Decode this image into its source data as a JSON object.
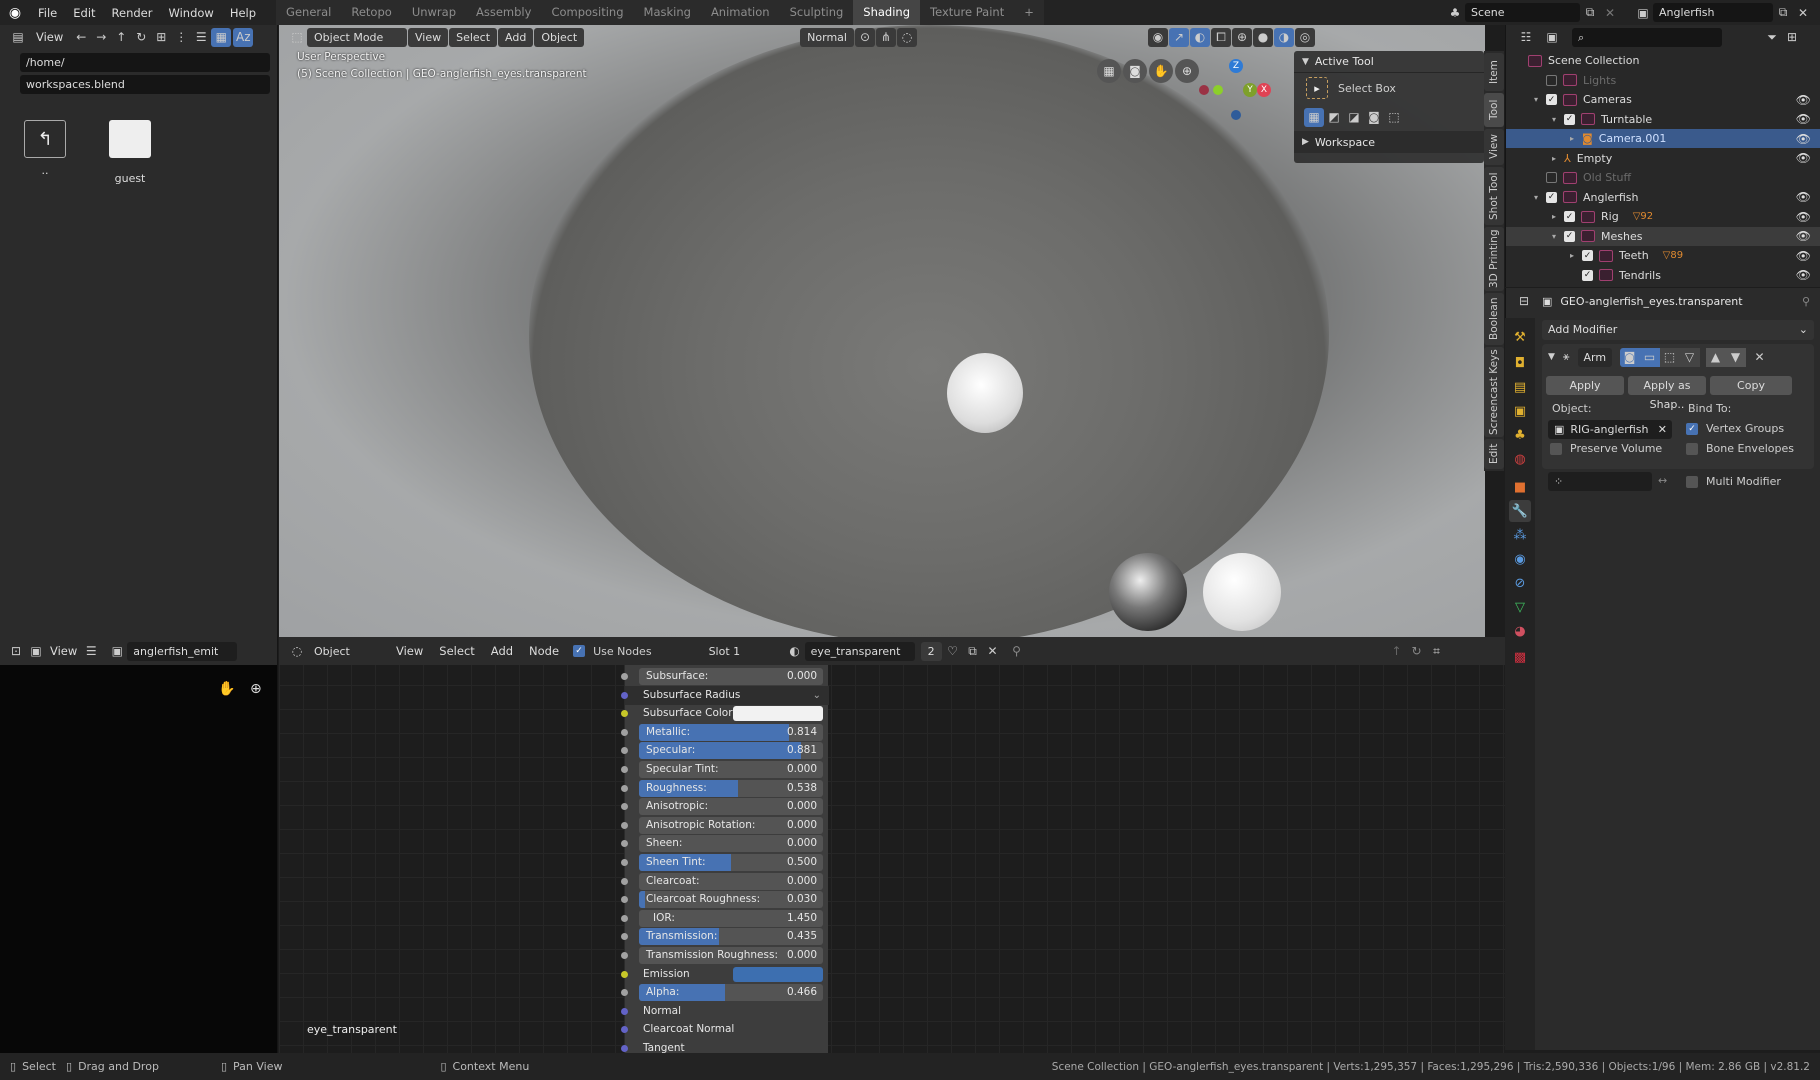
{
  "topbar": {
    "menus": [
      "File",
      "Edit",
      "Render",
      "Window",
      "Help"
    ],
    "workspace_tabs": [
      "General",
      "Retopo",
      "Unwrap",
      "Assembly",
      "Compositing",
      "Masking",
      "Animation",
      "Sculpting",
      "Shading",
      "Texture Paint"
    ],
    "active_tab": "Shading",
    "add_tab": "+",
    "scene": "Scene",
    "view_layer": "Anglerfish"
  },
  "filebrowser": {
    "view_label": "View",
    "path": "/home/",
    "filename": "workspaces.blend",
    "items": [
      {
        "name": "..",
        "icon": "parent-folder-icon"
      },
      {
        "name": "guest",
        "icon": "folder-icon"
      }
    ]
  },
  "viewport": {
    "mode": "Object Mode",
    "menus": [
      "View",
      "Select",
      "Add",
      "Object"
    ],
    "orientation": "Normal",
    "overlay_title": "User Perspective",
    "overlay_subtitle": "(5) Scene Collection | GEO-anglerfish_eyes.transparent",
    "gizmo_axes": [
      "Z",
      "Y",
      "X"
    ]
  },
  "npanel": {
    "active_tool_title": "Active Tool",
    "tool_name": "Select Box",
    "workspace_title": "Workspace",
    "tabs": [
      "Item",
      "Tool",
      "View",
      "Shot Tool",
      "3D Printing",
      "Boolean",
      "Screencast Keys",
      "Edit"
    ],
    "active_tab": "Tool"
  },
  "outliner": {
    "rows": [
      {
        "label": "Scene Collection",
        "depth": 0,
        "checkbox": null,
        "expand": "",
        "eye": false,
        "dim": false
      },
      {
        "label": "Lights",
        "depth": 1,
        "checkbox": false,
        "expand": "",
        "eye": false,
        "dim": true
      },
      {
        "label": "Cameras",
        "depth": 1,
        "checkbox": true,
        "expand": "▾",
        "eye": true,
        "dim": false
      },
      {
        "label": "Turntable",
        "depth": 2,
        "checkbox": true,
        "expand": "▾",
        "eye": true,
        "dim": false
      },
      {
        "label": "Camera.001",
        "depth": 3,
        "checkbox": null,
        "expand": "▸",
        "eye": true,
        "dim": false,
        "selected": true
      },
      {
        "label": "Empty",
        "depth": 2,
        "checkbox": null,
        "expand": "▸",
        "eye": true,
        "dim": false
      },
      {
        "label": "Old Stuff",
        "depth": 1,
        "checkbox": false,
        "expand": "",
        "eye": false,
        "dim": true
      },
      {
        "label": "Anglerfish",
        "depth": 1,
        "checkbox": true,
        "expand": "▾",
        "eye": true,
        "dim": false
      },
      {
        "label": "Rig",
        "depth": 2,
        "checkbox": true,
        "expand": "▸",
        "eye": true,
        "dim": false,
        "badge": "92"
      },
      {
        "label": "Meshes",
        "depth": 2,
        "checkbox": true,
        "expand": "▾",
        "eye": true,
        "dim": false,
        "highlight": true
      },
      {
        "label": "Teeth",
        "depth": 3,
        "checkbox": true,
        "expand": "▸",
        "eye": true,
        "dim": false,
        "badge": "89"
      },
      {
        "label": "Tendrils",
        "depth": 3,
        "checkbox": true,
        "expand": "",
        "eye": true,
        "dim": false
      }
    ]
  },
  "properties": {
    "object_name": "GEO-anglerfish_eyes.transparent",
    "add_modifier": "Add Modifier",
    "modifier_name": "Arm",
    "apply": "Apply",
    "apply_as_shape": "Apply as Shap..",
    "copy": "Copy",
    "object_label": "Object:",
    "object_value": "RIG-anglerfish",
    "bind_to_label": "Bind To:",
    "preserve_volume": {
      "label": "Preserve Volume",
      "checked": false
    },
    "vertex_groups": {
      "label": "Vertex Groups",
      "checked": true
    },
    "bone_envelopes": {
      "label": "Bone Envelopes",
      "checked": false
    },
    "multi_modifier": {
      "label": "Multi Modifier",
      "checked": false
    }
  },
  "image_editor": {
    "view_label": "View",
    "image_name": "anglerfish_emit"
  },
  "node_editor": {
    "object_type": "Object",
    "menus": [
      "View",
      "Select",
      "Add",
      "Node"
    ],
    "use_nodes": "Use Nodes",
    "slot": "Slot 1",
    "material": "eye_transparent",
    "users": "2",
    "frame_label": "eye_transparent"
  },
  "bsdf": {
    "inputs": [
      {
        "label": "Subsurface:",
        "value": "0.000",
        "fraction": 0,
        "type": "slider",
        "socket": "gray"
      },
      {
        "label": "Subsurface Radius",
        "type": "dropdown",
        "socket": "purple"
      },
      {
        "label": "Subsurface Color",
        "type": "color",
        "color": "#f2f2f2",
        "socket": "yellow"
      },
      {
        "label": "Metallic:",
        "value": "0.814",
        "fraction": 0.814,
        "type": "slider",
        "socket": "gray"
      },
      {
        "label": "Specular:",
        "value": "0.881",
        "fraction": 0.881,
        "type": "slider",
        "socket": "gray"
      },
      {
        "label": "Specular Tint:",
        "value": "0.000",
        "fraction": 0,
        "type": "slider",
        "socket": "gray"
      },
      {
        "label": "Roughness:",
        "value": "0.538",
        "fraction": 0.538,
        "type": "slider",
        "socket": "gray"
      },
      {
        "label": "Anisotropic:",
        "value": "0.000",
        "fraction": 0,
        "type": "slider",
        "socket": "gray"
      },
      {
        "label": "Anisotropic Rotation:",
        "value": "0.000",
        "fraction": 0,
        "type": "slider",
        "socket": "gray"
      },
      {
        "label": "Sheen:",
        "value": "0.000",
        "fraction": 0,
        "type": "slider",
        "socket": "gray"
      },
      {
        "label": "Sheen Tint:",
        "value": "0.500",
        "fraction": 0.5,
        "type": "slider",
        "socket": "gray"
      },
      {
        "label": "Clearcoat:",
        "value": "0.000",
        "fraction": 0,
        "type": "slider",
        "socket": "gray"
      },
      {
        "label": "Clearcoat Roughness:",
        "value": "0.030",
        "fraction": 0.03,
        "type": "slider",
        "socket": "gray"
      },
      {
        "label": "IOR:",
        "value": "1.450",
        "fraction": 0,
        "type": "number",
        "socket": "gray"
      },
      {
        "label": "Transmission:",
        "value": "0.435",
        "fraction": 0.435,
        "type": "slider",
        "socket": "gray"
      },
      {
        "label": "Transmission Roughness:",
        "value": "0.000",
        "fraction": 0,
        "type": "slider",
        "socket": "gray"
      },
      {
        "label": "Emission",
        "type": "color",
        "color": "#3d6fb0",
        "socket": "yellow"
      },
      {
        "label": "Alpha:",
        "value": "0.466",
        "fraction": 0.466,
        "type": "slider",
        "socket": "gray"
      },
      {
        "label": "Normal",
        "type": "label",
        "socket": "purple"
      },
      {
        "label": "Clearcoat Normal",
        "type": "label",
        "socket": "purple"
      },
      {
        "label": "Tangent",
        "type": "label",
        "socket": "purple"
      }
    ]
  },
  "statusbar": {
    "select": "Select",
    "drag_drop": "Drag and Drop",
    "pan_view": "Pan View",
    "context_menu": "Context Menu",
    "info": "Scene Collection | GEO-anglerfish_eyes.transparent | Verts:1,295,357 | Faces:1,295,296 | Tris:2,590,336 | Objects:1/96 | Mem: 2.86 GB | v2.81.2"
  },
  "colors": {
    "accent": "#4772b3",
    "selected_row": "#3a5a8c",
    "collection": "#a04070"
  }
}
